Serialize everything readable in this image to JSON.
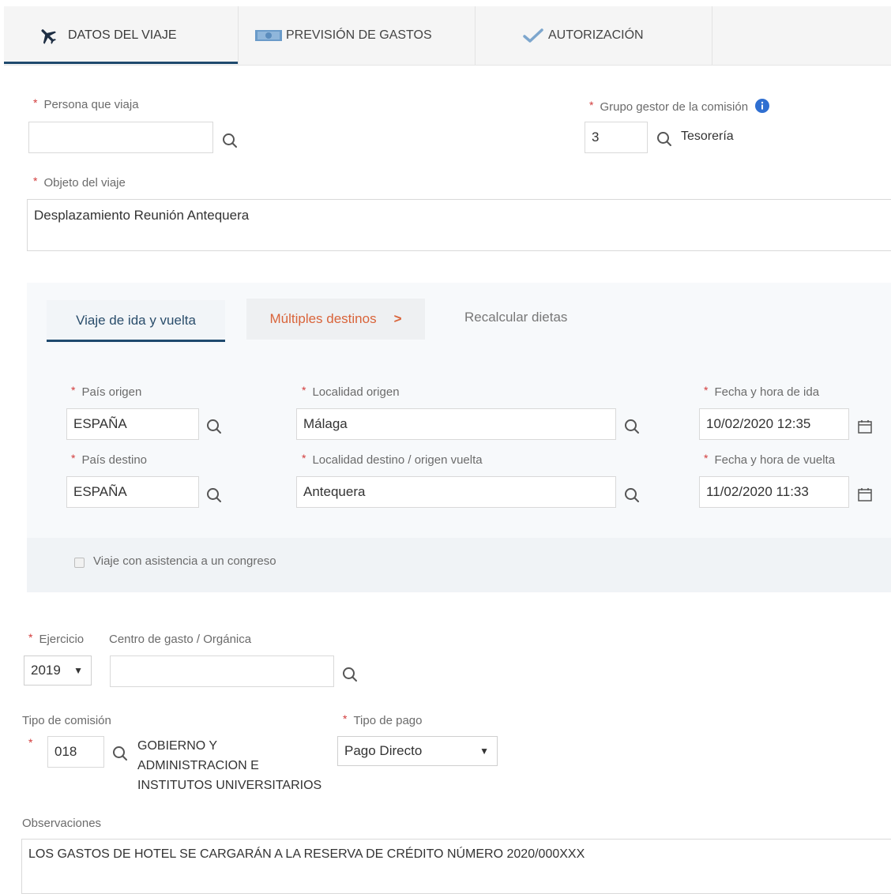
{
  "tabs": [
    {
      "label": "DATOS DEL VIAJE",
      "icon": "airplane-icon",
      "active": true
    },
    {
      "label": "PREVISIÓN DE GASTOS",
      "icon": "money-icon",
      "active": false
    },
    {
      "label": "AUTORIZACIÓN",
      "icon": "checkmark-icon",
      "active": false
    }
  ],
  "persona": {
    "label": "Persona que viaja",
    "value": ""
  },
  "grupo": {
    "label": "Grupo gestor de la comisión",
    "value": "3",
    "name": "Tesorería"
  },
  "objeto": {
    "label": "Objeto del viaje",
    "value": "Desplazamiento Reunión Antequera"
  },
  "trip": {
    "subtabs": [
      {
        "label": "Viaje de ida y vuelta",
        "active": true
      },
      {
        "label": "Múltiples destinos",
        "arrow": ">"
      },
      {
        "label": "Recalcular dietas"
      }
    ],
    "pais_origen": {
      "label": "País origen",
      "value": "ESPAÑA"
    },
    "localidad_origen": {
      "label": "Localidad origen",
      "value": "Málaga"
    },
    "fecha_ida": {
      "label": "Fecha y hora de ida",
      "value": "10/02/2020 12:35"
    },
    "pais_destino": {
      "label": "País destino",
      "value": "ESPAÑA"
    },
    "localidad_destino": {
      "label": "Localidad destino / origen vuelta",
      "value": "Antequera"
    },
    "fecha_vuelta": {
      "label": "Fecha y hora de vuelta",
      "value": "11/02/2020 11:33"
    },
    "congreso": {
      "label": "Viaje con asistencia a un congreso",
      "checked": false
    }
  },
  "ejercicio": {
    "label": "Ejercicio",
    "value": "2019"
  },
  "centro": {
    "label": "Centro de gasto / Orgánica",
    "value": ""
  },
  "tipo_comision": {
    "label": "Tipo de comisión",
    "code": "018",
    "desc_lines": [
      "GOBIERNO Y",
      "ADMINISTRACION E",
      "INSTITUTOS UNIVERSITARIOS"
    ]
  },
  "tipo_pago": {
    "label": "Tipo de pago",
    "value": "Pago Directo"
  },
  "observaciones": {
    "label": "Observaciones",
    "value": "LOS GASTOS DE HOTEL SE CARGARÁN A LA RESERVA DE CRÉDITO NÚMERO 2020/000XXX"
  },
  "colors": {
    "required": "#d23b3b",
    "active_tab": "#1f4a6e",
    "orange_tab": "#d9643a",
    "info": "#2f6fd1"
  }
}
